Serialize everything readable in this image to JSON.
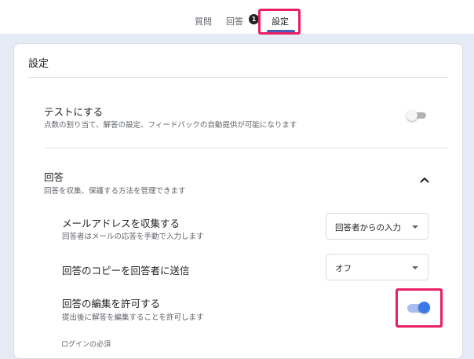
{
  "tabs": {
    "questions": "質問",
    "responses": "回答",
    "responses_badge": "1",
    "settings": "設定"
  },
  "card": {
    "title": "設定"
  },
  "quiz": {
    "title": "テストにする",
    "description": "点数の割り当て、解答の設定、フィードバックの自動提供が可能になります",
    "enabled": false
  },
  "responses": {
    "title": "回答",
    "description": "回答を収集、保護する方法を管理できます",
    "expanded": true,
    "collect_email": {
      "title": "メールアドレスを収集する",
      "description": "回答者はメールの応答を手動で入力します",
      "selected": "回答者からの入力"
    },
    "send_copy": {
      "title": "回答のコピーを回答者に送信",
      "selected": "オフ"
    },
    "allow_edit": {
      "title": "回答の編集を許可する",
      "description": "提出後に解答を編集することを許可します",
      "enabled": true
    },
    "login_required": "ログインの必須"
  },
  "colors": {
    "highlight": "#ea1e63",
    "accent": "#3c78e6",
    "tab_underline": "#4a5dbd",
    "page_background": "#e4ebf5"
  },
  "icons": {
    "chevron": "chevron-up-icon",
    "dropdown": "dropdown-arrow-icon"
  }
}
